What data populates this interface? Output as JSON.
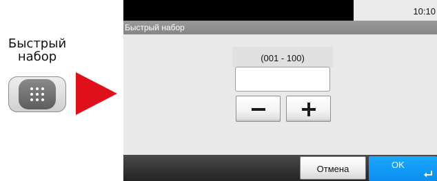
{
  "instruction": {
    "caption_line1": "Быстрый",
    "caption_line2": "набор",
    "key_icon": "keypad-icon",
    "arrow_color": "#e0101a"
  },
  "status_bar": {
    "time": "10:10"
  },
  "title_bar": {
    "title": "Быстрый набор"
  },
  "dialog": {
    "range_label": "(001 - 100)",
    "input_value": "",
    "minus_icon": "minus-icon",
    "plus_icon": "plus-icon"
  },
  "bottom_bar": {
    "cancel_label": "Отмена",
    "ok_label": "OK",
    "ok_icon": "enter-icon",
    "ok_color": "#0b8ef0"
  }
}
